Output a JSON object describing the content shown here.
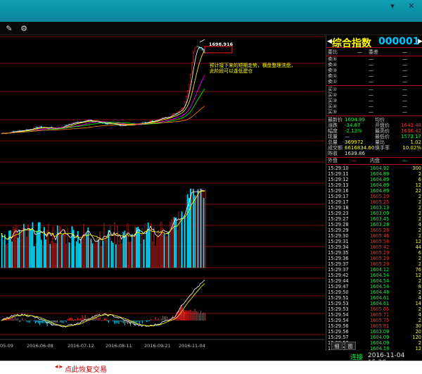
{
  "window": {
    "close_glyph": "✕",
    "menu_glyph": "▾"
  },
  "toolbar": {
    "draw_glyph": "✎",
    "settings_glyph": "⚙"
  },
  "chart": {
    "annotation": [
      "预计接下来的短期走势，横盘整理洗盘，",
      "此阶段可以逢低建仓"
    ],
    "high_label": "1698.916",
    "x_dates": [
      "05-09",
      "2016-06-08",
      "2016-07-12",
      "2016-08-11",
      "2016-09-21",
      "2016-11-04"
    ]
  },
  "chart_data": {
    "type": "line",
    "title": "",
    "note": "index close values (approx.) read from the price pane, plus volume and oscillator panes",
    "x": [
      "05-09",
      "2016-06-08",
      "2016-07-12",
      "2016-08-11",
      "2016-09-21",
      "2016-11-04"
    ],
    "series": [
      {
        "name": "",
        "values": [
          820,
          870,
          960,
          905,
          1030,
          1604.99
        ]
      }
    ],
    "peak": 1698.916
  },
  "quote": {
    "name": "综合指数",
    "code": "000001",
    "left_arrow": "◀",
    "right_arrow": "▶",
    "ratio_label": "委比",
    "ratio_val": "—",
    "diff_label": "委差",
    "diff_val": "—",
    "sells": [
      {
        "label": "卖⑤",
        "price": "—",
        "vol": "—"
      },
      {
        "label": "卖④",
        "price": "—",
        "vol": "—"
      },
      {
        "label": "卖③",
        "price": "—",
        "vol": "—"
      },
      {
        "label": "卖②",
        "price": "—",
        "vol": "—"
      },
      {
        "label": "卖①",
        "price": "—",
        "vol": "—"
      }
    ],
    "buys": [
      {
        "label": "买①",
        "price": "—",
        "vol": "—"
      },
      {
        "label": "买②",
        "price": "—",
        "vol": "—"
      },
      {
        "label": "买③",
        "price": "—",
        "vol": "—"
      },
      {
        "label": "买④",
        "price": "—",
        "vol": "—"
      },
      {
        "label": "买⑤",
        "price": "—",
        "vol": "—"
      }
    ],
    "stats": [
      {
        "l1": "最新价",
        "v1": "1604.99",
        "l2": "均价",
        "v2": ""
      },
      {
        "l1": "涨跌",
        "v1": "-34.87",
        "l2": "开盘价",
        "v2": "1643.48"
      },
      {
        "l1": "幅度",
        "v1": "-2.13%",
        "l2": "最高价",
        "v2": "1656.42"
      },
      {
        "l1": "现量",
        "v1": "—",
        "l2": "最低价",
        "v2": "1573.17"
      },
      {
        "l1": "总量",
        "v1": "369972",
        "l2": "量比",
        "v2": "1.02"
      },
      {
        "l1": "成交额",
        "v1": "6616834.60",
        "l2": "换手率",
        "v2": "10.02%"
      },
      {
        "l1": "昨收",
        "v1": "1639.86",
        "l2": "",
        "v2": ""
      }
    ],
    "outer_label": "外盘",
    "outer_val": "—",
    "inner_label": "内盘",
    "inner_val": "—"
  },
  "ticks": [
    {
      "t": "15:29:10",
      "p": "1604.92",
      "v": "300"
    },
    {
      "t": "15:29:11",
      "p": "1604.89",
      "v": "2"
    },
    {
      "t": "15:29:12",
      "p": "1604.89",
      "v": "6"
    },
    {
      "t": "15:29:13",
      "p": "1604.89",
      "v": "12"
    },
    {
      "t": "15:29:16",
      "p": "1604.89",
      "v": "22"
    },
    {
      "t": "15:29:17",
      "p": "1605.20",
      "v": "2"
    },
    {
      "t": "15:29:17",
      "p": "1605.25",
      "v": "2"
    },
    {
      "t": "15:29:18",
      "p": "1603.13",
      "v": "2"
    },
    {
      "t": "15:29:23",
      "p": "1603.09",
      "v": "2"
    },
    {
      "t": "15:29:27",
      "p": "1603.45",
      "v": "2"
    },
    {
      "t": "15:29:28",
      "p": "1603.28",
      "v": "4"
    },
    {
      "t": "15:29:29",
      "p": "1605.28",
      "v": "2"
    },
    {
      "t": "15:29:30",
      "p": "1605.46",
      "v": "2"
    },
    {
      "t": "15:29:31",
      "p": "1605.58",
      "v": "12"
    },
    {
      "t": "15:29:34",
      "p": "1605.42",
      "v": "44"
    },
    {
      "t": "15:29:35",
      "p": "1605.29",
      "v": "6"
    },
    {
      "t": "15:29:36",
      "p": "1605.29",
      "v": "2"
    },
    {
      "t": "15:29:37",
      "p": "1605.29",
      "v": "2"
    },
    {
      "t": "15:29:37",
      "p": "1604.12",
      "v": "76"
    },
    {
      "t": "15:29:42",
      "p": "1604.54",
      "v": "12"
    },
    {
      "t": "15:29:44",
      "p": "1604.54",
      "v": "2"
    },
    {
      "t": "15:29:47",
      "p": "1604.54",
      "v": "8"
    },
    {
      "t": "15:29:50",
      "p": "1604.48",
      "v": "2"
    },
    {
      "t": "15:29:51",
      "p": "1604.61",
      "v": "4"
    },
    {
      "t": "15:29:53",
      "p": "1604.61",
      "v": "14"
    },
    {
      "t": "15:29:53",
      "p": "1605.65",
      "v": "2"
    },
    {
      "t": "15:29:54",
      "p": "1605.71",
      "v": "4"
    },
    {
      "t": "15:29:54",
      "p": "1605.75",
      "v": "2"
    },
    {
      "t": "15:29:56",
      "p": "1605.81",
      "v": "30"
    },
    {
      "t": "15:29:56",
      "p": "1603.09",
      "v": "20"
    },
    {
      "t": "15:29:57",
      "p": "1604.09",
      "v": "120"
    },
    {
      "t": "15:29:58",
      "p": "1604.09",
      "v": "2"
    },
    {
      "t": "15:29:59",
      "p": "1604.18",
      "v": "12"
    },
    {
      "t": "15:29:59",
      "p": "1604.36",
      "v": "186"
    },
    {
      "t": "15:30:01",
      "p": "1604.99",
      "v": "202"
    }
  ],
  "panel_tabs": [
    "细",
    "图"
  ],
  "status": {
    "connection": "连接",
    "datetime": "2016-11-04  15:30"
  },
  "bottom": {
    "restore_icon": "◀||▶",
    "restore_text": "点此恢复交易"
  },
  "colors": {
    "up": "#ff3030",
    "down": "#00e0ff",
    "grid": "#b01010",
    "ma5": "#ffffff",
    "ma10": "#ffff00",
    "ma20": "#ff00ff",
    "ma30": "#00ff00",
    "ma60": "#ff8000"
  }
}
